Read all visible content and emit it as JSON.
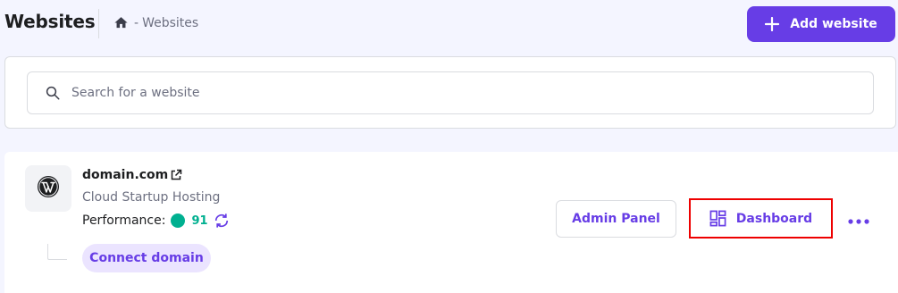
{
  "header": {
    "title": "Websites",
    "breadcrumb": {
      "separator": "-",
      "current": "Websites"
    },
    "add_button_label": "Add website"
  },
  "search": {
    "placeholder": "Search for a website",
    "value": ""
  },
  "website": {
    "domain": "domain.com",
    "plan": "Cloud Startup Hosting",
    "performance_label": "Performance:",
    "performance_score": "91",
    "connect_domain_label": "Connect domain",
    "admin_panel_label": "Admin Panel",
    "dashboard_label": "Dashboard"
  },
  "icons": {
    "home": "home-icon",
    "plus": "plus-icon",
    "search": "search-icon",
    "wordpress": "wordpress-logo-icon",
    "external_link": "external-link-icon",
    "refresh": "refresh-icon",
    "dashboard": "dashboard-grid-icon",
    "more": "more-horizontal-icon"
  },
  "colors": {
    "accent": "#673de6",
    "performance_good": "#00b090",
    "highlight_border": "#ee0000",
    "page_background": "#f4f5ff"
  }
}
